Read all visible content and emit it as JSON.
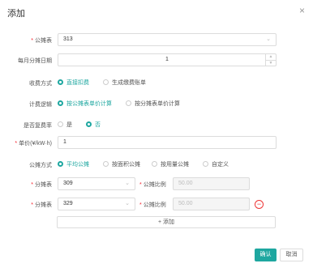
{
  "dialog": {
    "title": "添加",
    "close": "×"
  },
  "form": {
    "meter": {
      "label": "公摊表",
      "value": "313"
    },
    "day": {
      "label": "每月分摊日期",
      "value": "1"
    },
    "charge_mode": {
      "label": "收费方式",
      "options": [
        "直接扣费",
        "生成缴费账单"
      ],
      "selected": 0
    },
    "calc_logic": {
      "label": "计费逻辑",
      "options": [
        "按公摊表单价计算",
        "按分摊表单价计算"
      ],
      "selected": 0
    },
    "reuse_rate": {
      "label": "是否复费率",
      "options": [
        "是",
        "否"
      ],
      "selected": 1
    },
    "price": {
      "label": "单价(¥/kW·h)",
      "value": "1"
    },
    "share_mode": {
      "label": "公摊方式",
      "options": [
        "平均公摊",
        "按面积公摊",
        "按用量公摊",
        "自定义"
      ],
      "selected": 0
    },
    "rows": [
      {
        "meter_label": "分摊表",
        "meter_value": "309",
        "ratio_label": "公摊比例",
        "ratio_value": "50.00"
      },
      {
        "meter_label": "分摊表",
        "meter_value": "329",
        "ratio_label": "公摊比例",
        "ratio_value": "50.00"
      }
    ],
    "add_label": "+ 添加"
  },
  "footer": {
    "ok": "确认",
    "cancel": "取消"
  }
}
